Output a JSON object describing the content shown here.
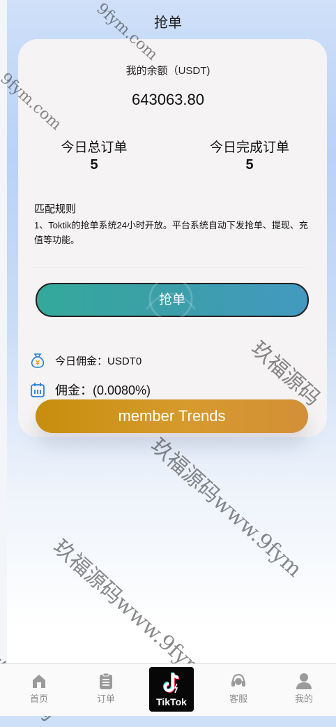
{
  "header": {
    "title": "抢单"
  },
  "balance": {
    "label": "我的余额（USDT)",
    "value": "643063.80"
  },
  "stats": [
    {
      "label": "今日总订单",
      "value": "5"
    },
    {
      "label": "今日完成订单",
      "value": "5"
    }
  ],
  "rules": {
    "title": "匹配规则",
    "text": "1、Toktik的抢单系统24小时开放。平台系统自动下发抢单、提现、充值等功能。"
  },
  "actions": {
    "grab_label": "抢单",
    "member_label": "member Trends"
  },
  "commission": {
    "today": "今日佣金：USDT0",
    "rate": "佣金：(0.0080%)"
  },
  "tabs": [
    {
      "label": "首页",
      "icon": "home-icon"
    },
    {
      "label": "订单",
      "icon": "clipboard-icon"
    },
    {
      "label": "TikTok",
      "icon": "tiktok-logo"
    },
    {
      "label": "客服",
      "icon": "headset-icon"
    },
    {
      "label": "我的",
      "icon": "user-icon"
    }
  ],
  "watermarks": {
    "domain": "9fym.com",
    "brand": "玖福源码",
    "long": "玖福源码www.9fym"
  },
  "colors": {
    "grab_button_start": "#34a99a",
    "grab_button_end": "#4399c0",
    "member_button": "#d69a2d",
    "card": "#f5f3f3"
  }
}
